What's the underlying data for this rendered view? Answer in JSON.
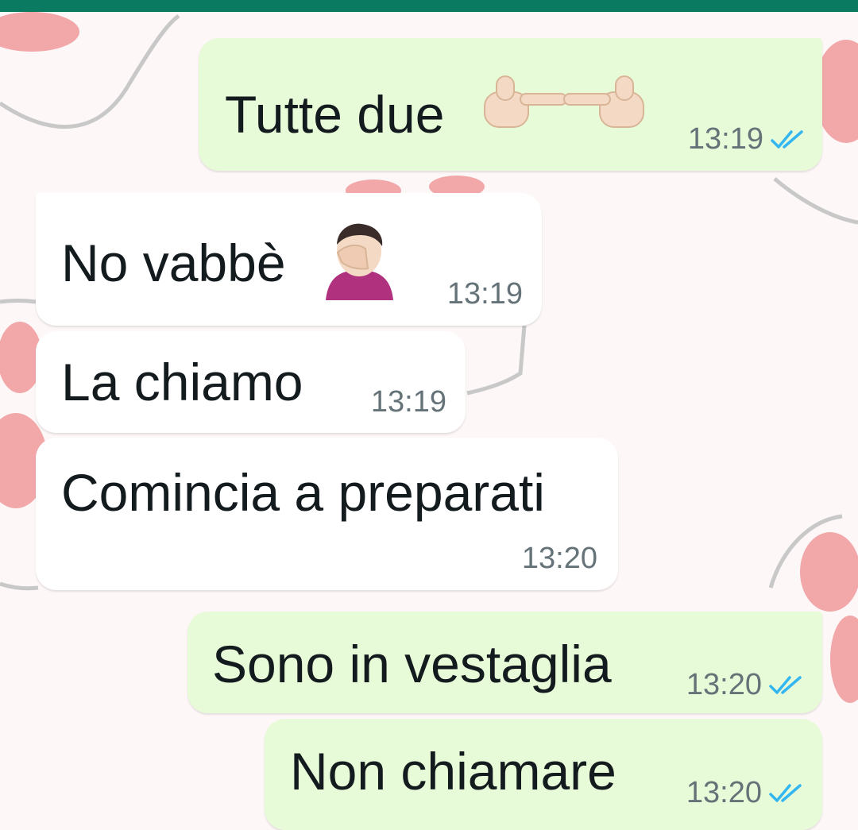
{
  "colors": {
    "header": "#0a7a60",
    "outgoing_bubble": "#e8fbd8",
    "incoming_bubble": "#ffffff",
    "read_ticks": "#34b7f1",
    "timestamp": "#657379"
  },
  "messages": [
    {
      "direction": "outgoing",
      "text": "Tutte due",
      "emoji": "backhand-index-pointing-left-and-right",
      "time": "13:19",
      "status": "read"
    },
    {
      "direction": "incoming",
      "text": "No vabbè",
      "emoji": "man-facepalming",
      "time": "13:19"
    },
    {
      "direction": "incoming",
      "text": "La chiamo",
      "time": "13:19"
    },
    {
      "direction": "incoming",
      "text": "Comincia a preparati",
      "time": "13:20"
    },
    {
      "direction": "outgoing",
      "text": "Sono in vestaglia",
      "time": "13:20",
      "status": "read"
    },
    {
      "direction": "outgoing",
      "text": "Non chiamare",
      "time": "13:20",
      "status": "read"
    }
  ]
}
